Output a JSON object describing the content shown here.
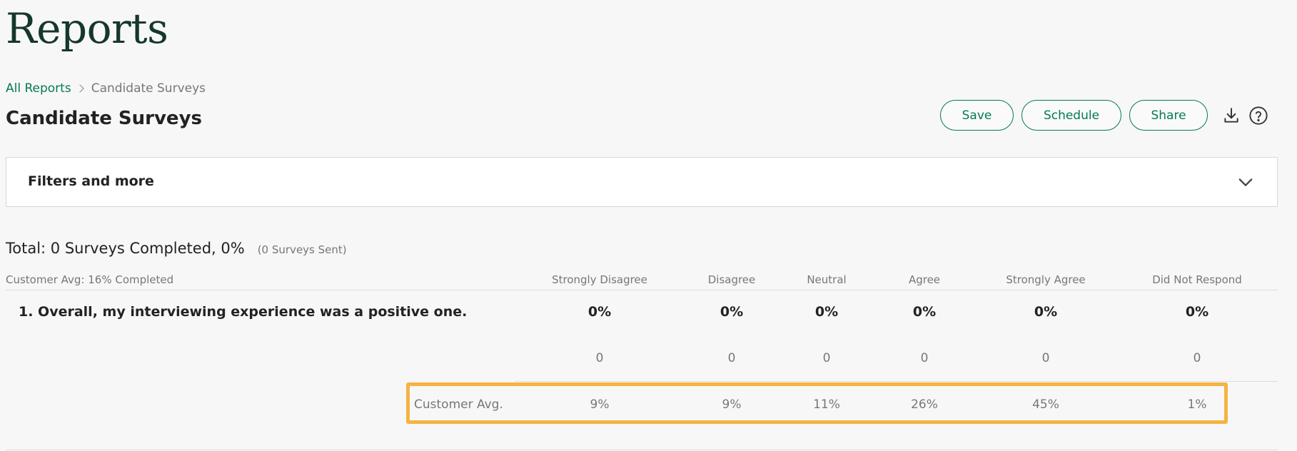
{
  "page": {
    "heading": "Reports"
  },
  "breadcrumb": {
    "root": "All Reports",
    "current": "Candidate Surveys"
  },
  "report": {
    "title": "Candidate Surveys"
  },
  "actions": {
    "save": "Save",
    "schedule": "Schedule",
    "share": "Share",
    "download_icon": "download-icon",
    "help_icon": "help-icon"
  },
  "filters": {
    "label": "Filters and more",
    "icon": "chevron-down-icon"
  },
  "summary": {
    "total": "Total: 0 Surveys Completed, 0%",
    "sent": "(0 Surveys Sent)"
  },
  "table": {
    "header_left": "Customer Avg: 16% Completed",
    "columns": [
      "Strongly Disagree",
      "Disagree",
      "Neutral",
      "Agree",
      "Strongly Agree",
      "Did Not Respond"
    ],
    "question": "1. Overall, my interviewing experience was a positive one.",
    "percentages": [
      "0%",
      "0%",
      "0%",
      "0%",
      "0%",
      "0%"
    ],
    "counts": [
      "0",
      "0",
      "0",
      "0",
      "0",
      "0"
    ],
    "avg_label": "Customer Avg.",
    "avg_values": [
      "9%",
      "9%",
      "11%",
      "26%",
      "45%",
      "1%"
    ]
  },
  "colors": {
    "accent": "#047a55",
    "heading": "#15372c",
    "highlight": "#f5b342"
  }
}
